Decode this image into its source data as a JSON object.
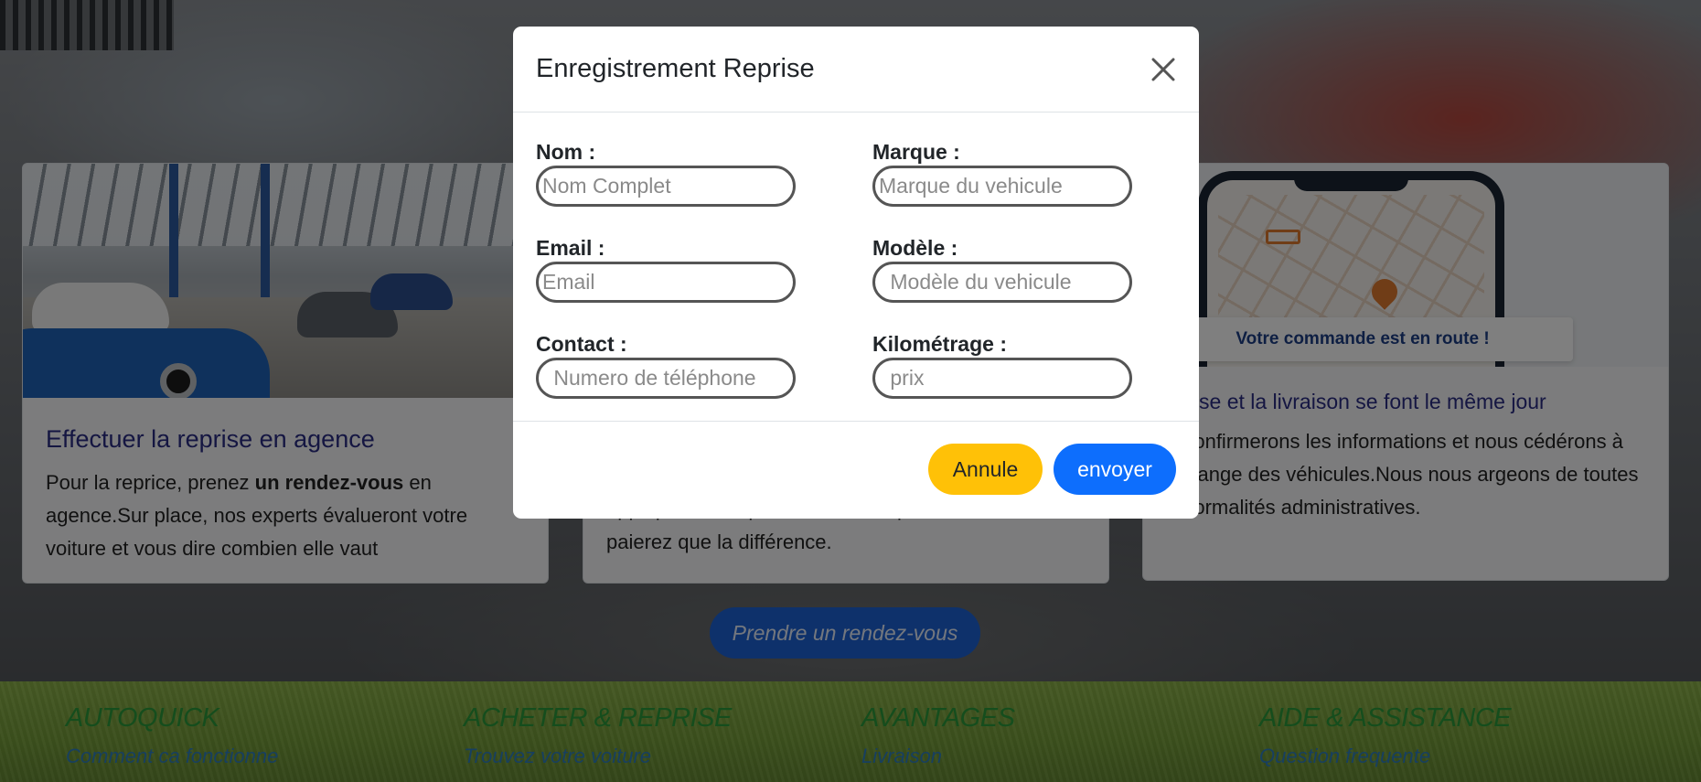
{
  "modal": {
    "title": "Enregistrement Reprise",
    "fields": {
      "nom": {
        "label": "Nom :",
        "placeholder": "Nom Complet",
        "value": ""
      },
      "email": {
        "label": "Email :",
        "placeholder": "Email",
        "value": ""
      },
      "contact": {
        "label": "Contact :",
        "placeholder": " Numero de téléphone",
        "value": ""
      },
      "marque": {
        "label": "Marque :",
        "placeholder": "Marque du vehicule",
        "value": ""
      },
      "modele": {
        "label": "Modèle :",
        "placeholder": " Modèle du vehicule",
        "value": ""
      },
      "kilometrage": {
        "label": "Kilométrage :",
        "placeholder": " prix",
        "value": ""
      }
    },
    "cancel_label": "Annule",
    "send_label": "envoyer"
  },
  "cards": [
    {
      "title": "Effectuer la reprise en agence",
      "text_before": "Pour la reprice, prenez ",
      "text_bold": "un rendez-vous",
      "text_after": " en agence.Sur place, nos experts évalueront votre voiture et vous dire combien elle vaut"
    },
    {
      "title": "",
      "text_partial": "appliquez votre prix de vente au paiement. Vous ne paierez que la différence."
    },
    {
      "title": "reprise et la livraison se font le même jour",
      "text": "us confirmerons les informations et nous cédérons à l'échange des véhicules.Nous nous argeons de toutes les formalités administratives.",
      "image_banner": "Votre commande est en route !"
    }
  ],
  "cta_label": "Prendre un rendez-vous",
  "footer": [
    {
      "heading": "AUTOQUICK",
      "link": "Comment ca fonctionne"
    },
    {
      "heading": "ACHETER & REPRISE",
      "link": "Trouvez votre voiture"
    },
    {
      "heading": "AVANTAGES",
      "link": "Livraison"
    },
    {
      "heading": "AIDE & ASSISTANCE",
      "link": "Question frequente"
    }
  ],
  "colors": {
    "card_title": "#2a2d84",
    "cancel_button": "#ffc107",
    "send_button": "#0d6efd",
    "cta_button": "#1d63d6",
    "footer_heading": "#2a9a3a",
    "footer_link": "#2f7fc0"
  },
  "icons": {
    "close": "close-icon",
    "truck": "truck-icon",
    "map_pin": "map-pin-icon"
  }
}
